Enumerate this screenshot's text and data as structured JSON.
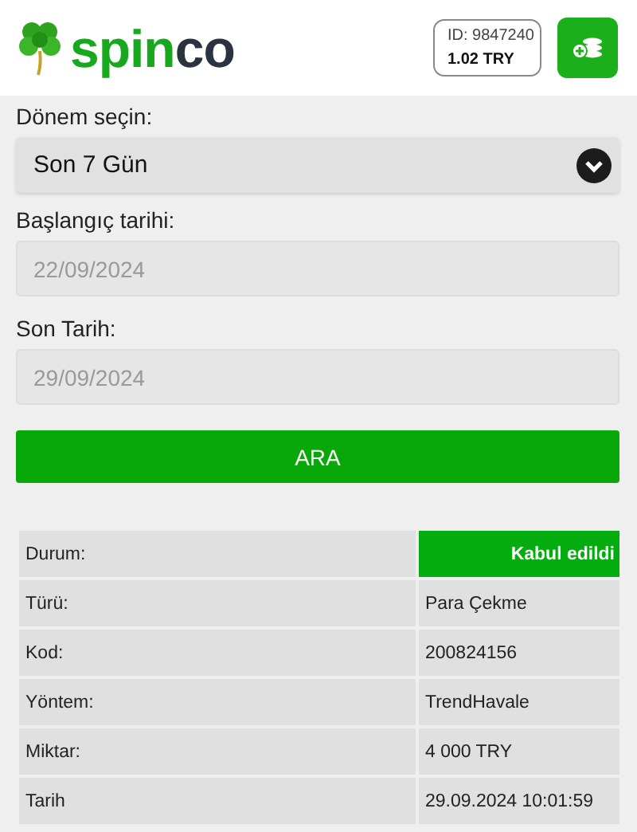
{
  "header": {
    "logo_first": "spin",
    "logo_second": "co",
    "account": {
      "id": "ID: 9847240",
      "balance": "1.02 TRY"
    }
  },
  "form": {
    "period": {
      "label": "Dönem seçin:",
      "value": "Son 7 Gün"
    },
    "start": {
      "label": "Başlangıç tarihi:",
      "placeholder": "22/09/2024"
    },
    "end": {
      "label": "Son Tarih:",
      "placeholder": "29/09/2024"
    },
    "search_button": "ARA"
  },
  "details": [
    {
      "label": "Durum:",
      "value": "Kabul edildi",
      "kind": "status"
    },
    {
      "label": "Türü:",
      "value": "Para Çekme",
      "kind": "plain"
    },
    {
      "label": "Kod:",
      "value": "200824156",
      "kind": "plain"
    },
    {
      "label": "Yöntem:",
      "value": "TrendHavale",
      "kind": "plain"
    },
    {
      "label": "Miktar:",
      "value": "4 000 TRY",
      "kind": "plain"
    },
    {
      "label": "Tarih",
      "value": "29.09.2024 10:01:59",
      "kind": "plain"
    }
  ]
}
